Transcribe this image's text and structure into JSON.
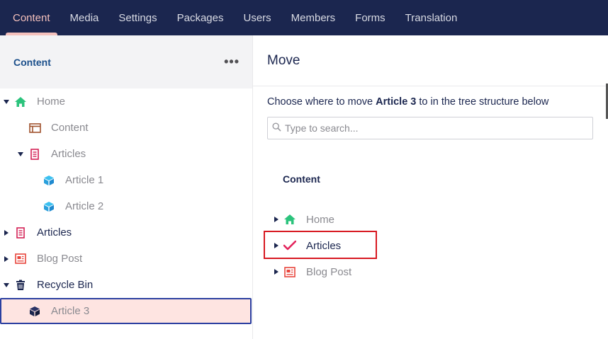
{
  "topnav": {
    "tabs": [
      "Content",
      "Media",
      "Settings",
      "Packages",
      "Users",
      "Members",
      "Forms",
      "Translation"
    ],
    "active": "Content"
  },
  "sidebar": {
    "title": "Content",
    "more_label": "•••",
    "tree": [
      {
        "label": "Home",
        "icon": "home-icon"
      },
      {
        "label": "Content",
        "icon": "layout-icon"
      },
      {
        "label": "Articles",
        "icon": "document-list-icon"
      },
      {
        "label": "Article 1",
        "icon": "box-icon"
      },
      {
        "label": "Article 2",
        "icon": "box-icon"
      },
      {
        "label": "Articles",
        "icon": "document-list-icon"
      },
      {
        "label": "Blog Post",
        "icon": "newspaper-icon"
      },
      {
        "label": "Recycle Bin",
        "icon": "trash-icon"
      },
      {
        "label": "Article 3",
        "icon": "box-icon"
      }
    ]
  },
  "move_panel": {
    "title": "Move",
    "instruction_prefix": "Choose where to move ",
    "instruction_item": "Article 3",
    "instruction_suffix": " to in the tree structure below",
    "search_placeholder": "Type to search...",
    "tree_title": "Content",
    "tree": [
      {
        "label": "Home",
        "icon": "home-icon"
      },
      {
        "label": "Articles",
        "icon": "checkmark-icon",
        "selected": true
      },
      {
        "label": "Blog Post",
        "icon": "newspaper-icon"
      }
    ]
  },
  "colors": {
    "nav_bg": "#1b264f",
    "active_tab": "#f5c1bc",
    "selected_row_bg": "#fee4e1",
    "highlight_border": "#d81921"
  }
}
